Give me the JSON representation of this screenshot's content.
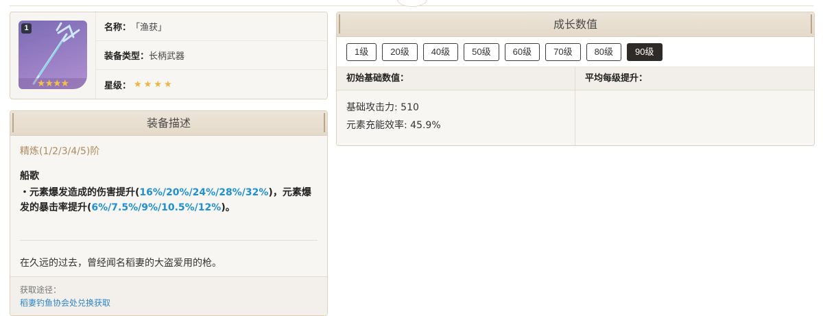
{
  "weapon": {
    "refine_badge": "1",
    "art_stars": "★★★★",
    "name_label": "名称：",
    "name_value": "「渔获」",
    "type_label": "装备类型：",
    "type_value": "长柄武器",
    "rarity_label": "星级：",
    "rarity_stars": "★★★★",
    "rarity": 4
  },
  "description": {
    "header": "装备描述",
    "refine_title": "精炼(1/2/3/4/5)阶",
    "passive_name": "船歌",
    "passive_p1": "・元素爆发造成的伤害提升(",
    "passive_v1": "16%/20%/24%/28%/32%",
    "passive_p2": ")，元素爆发的暴击率提升(",
    "passive_v2": "6%/7.5%/9%/10.5%/12%",
    "passive_p3": ")。",
    "lore": "在久远的过去，曾经闻名稻妻的大盗爱用的枪。",
    "source_label": "获取途径：",
    "source_link": "稻妻钓鱼协会处兑换获取"
  },
  "growth": {
    "header": "成长数值",
    "levels": [
      "1级",
      "20级",
      "40级",
      "50级",
      "60级",
      "70级",
      "80级",
      "90级"
    ],
    "active_level": "90级",
    "col_base": "初始基础数值：",
    "col_avg": "平均每级提升：",
    "stat1": "基础攻击力: 510",
    "stat2": "元素充能效率: 45.9%"
  },
  "colors": {
    "accent_highlight": "#1e90d6",
    "refine_title": "#b08a5c",
    "star": "#f2b33d",
    "active_button": "#2d2a27"
  }
}
